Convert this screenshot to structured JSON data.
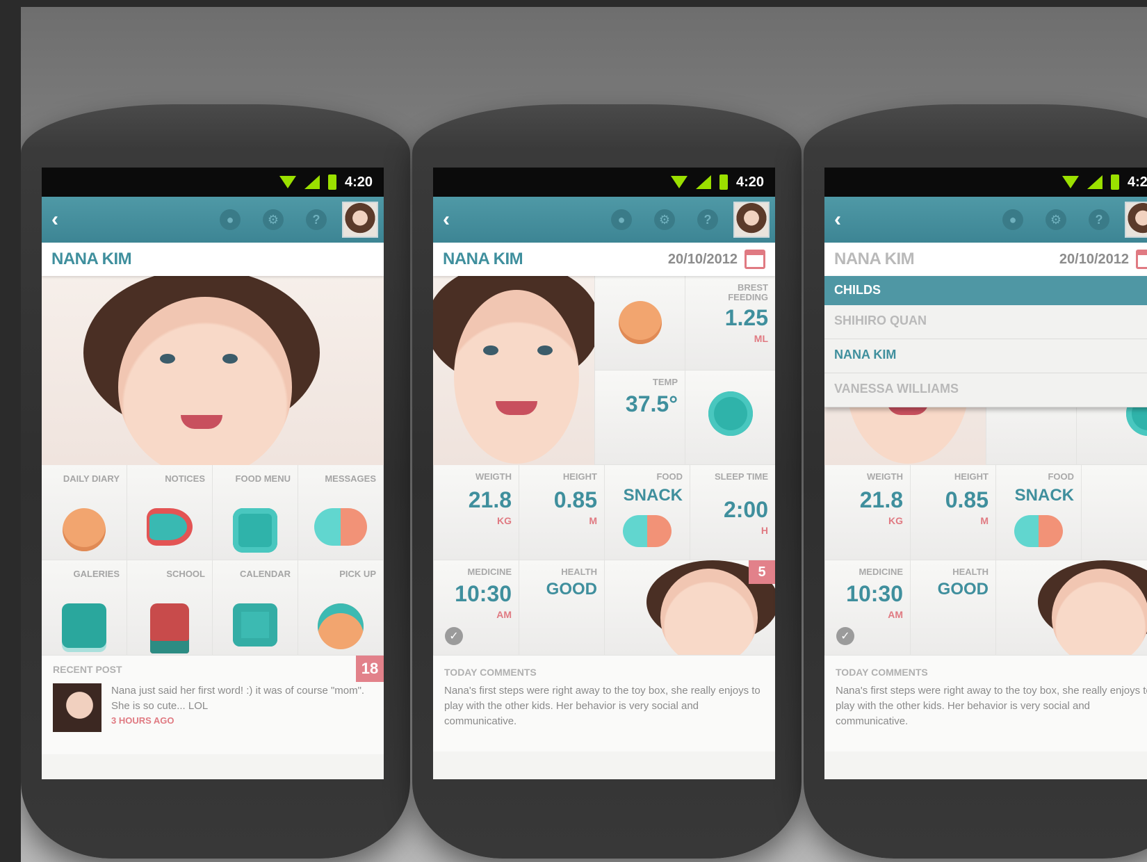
{
  "status_bar": {
    "time": "4:20"
  },
  "header": {
    "child_name": "NANA KIM",
    "date": "20/10/2012"
  },
  "phone1": {
    "tiles": [
      {
        "label": "DAILY DIARY",
        "icon": "baby-face-icon"
      },
      {
        "label": "NOTICES",
        "icon": "megaphone-icon"
      },
      {
        "label": "FOOD MENU",
        "icon": "food-plate-icon"
      },
      {
        "label": "MESSAGES",
        "icon": "chat-bubbles-icon"
      },
      {
        "label": "GALERIES",
        "icon": "gallery-icon"
      },
      {
        "label": "SCHOOL",
        "icon": "school-bus-icon"
      },
      {
        "label": "CALENDAR",
        "icon": "calendar-icon"
      },
      {
        "label": "PICK UP",
        "icon": "glasses-face-icon"
      }
    ],
    "recent_post": {
      "heading": "RECENT POST",
      "badge": "18",
      "text": "Nana just said her first word! :) it was of course \"mom\". She is so cute... LOL",
      "time": "3 HOURS AGO"
    }
  },
  "dashboard": {
    "breastfeeding": {
      "label": "BREST FEEDING",
      "value": "1.25",
      "unit": "ML"
    },
    "temp": {
      "label": "TEMP",
      "value": "37.5°"
    },
    "weight": {
      "label": "WEIGTH",
      "value": "21.8",
      "unit": "KG"
    },
    "height": {
      "label": "HEIGHT",
      "value": "0.85",
      "unit": "M"
    },
    "food": {
      "label": "FOOD",
      "value": "SNACK"
    },
    "sleep": {
      "label": "SLEEP TIME",
      "value": "2:00",
      "unit": "H"
    },
    "medicine": {
      "label": "MEDICINE",
      "value": "10:30",
      "unit": "AM"
    },
    "health": {
      "label": "HEALTH",
      "value": "GOOD"
    },
    "photo_badge": "5",
    "comments": {
      "heading": "TODAY COMMENTS",
      "text": "Nana's first steps were right away to the toy box, she really enjoys to play with the other kids. Her behavior is very social and communicative."
    }
  },
  "childs_menu": {
    "heading": "CHILDS",
    "items": [
      "SHIHIRO QUAN",
      "NANA KIM",
      "VANESSA WILLIAMS"
    ],
    "active": "NANA KIM"
  },
  "colors": {
    "teal": "#3f8f9d",
    "header": "#4f99a6",
    "pink": "#e2818a"
  }
}
